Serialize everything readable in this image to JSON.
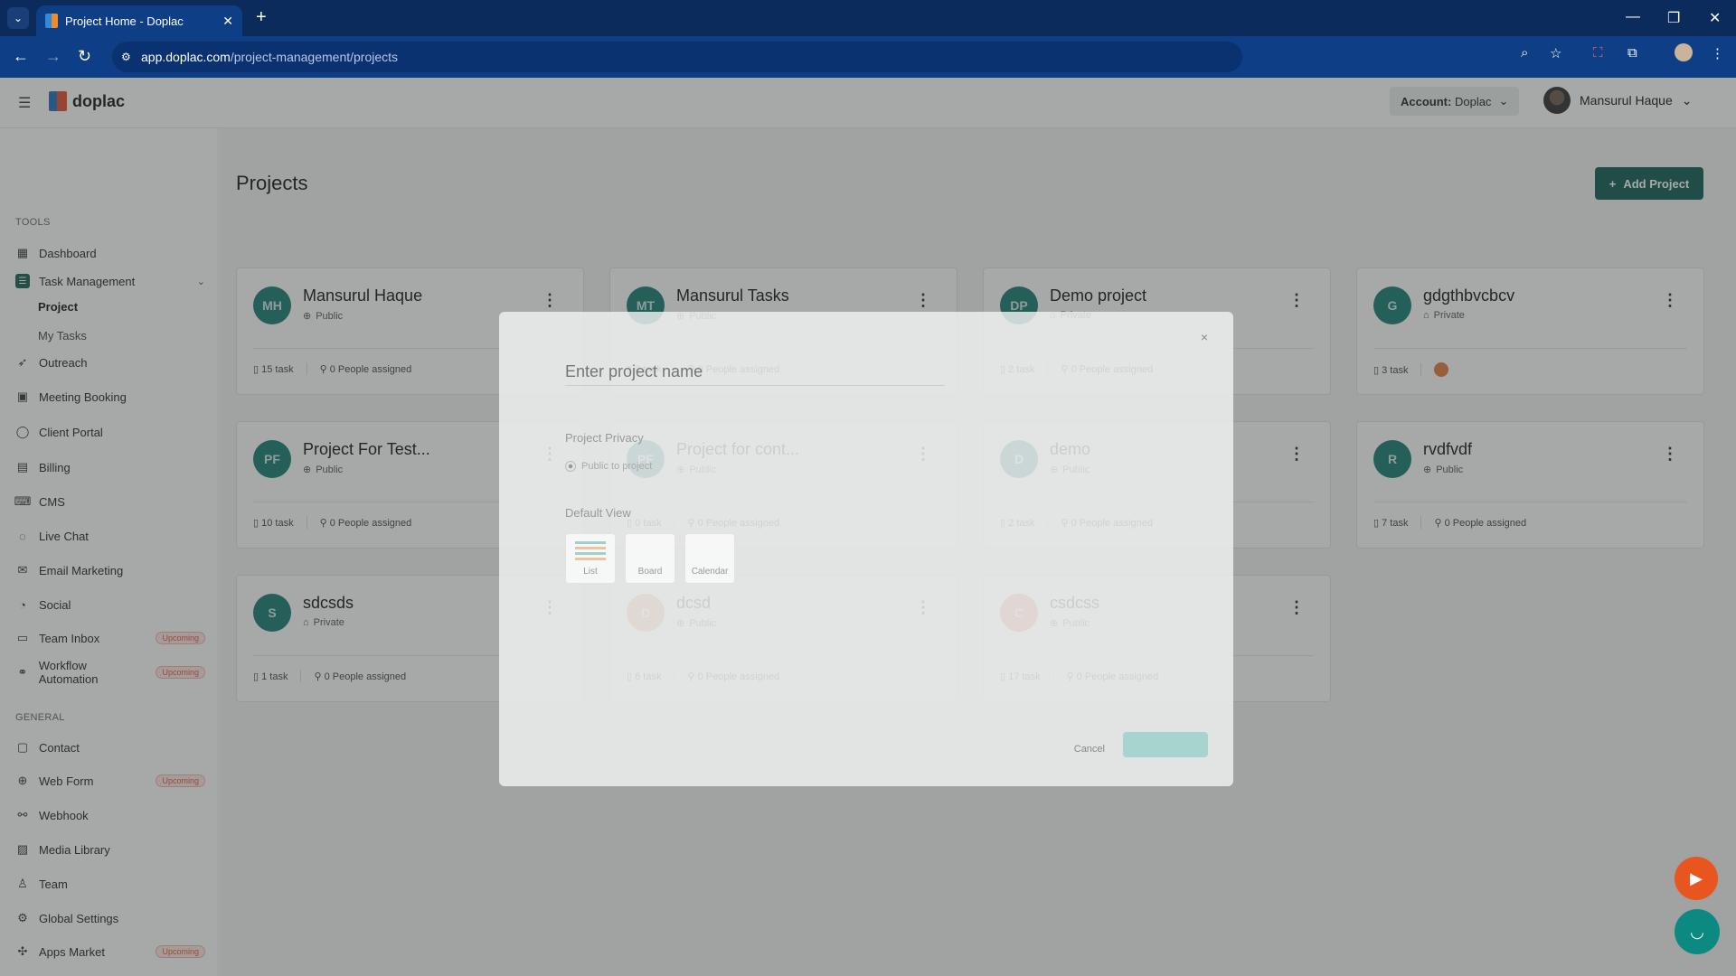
{
  "browser": {
    "tab_title": "Project Home - Doplac",
    "url_host": "app.doplac.com",
    "url_path": "/project-management/projects"
  },
  "header": {
    "logo_text": "doplac",
    "account_label": "Account:",
    "account_value": "Doplac",
    "user_name": "Mansurul Haque"
  },
  "sidebar": {
    "tools_label": "TOOLS",
    "general_label": "GENERAL",
    "tools": [
      {
        "label": "Dashboard",
        "icon": "grid-icon"
      },
      {
        "label": "Task Management",
        "icon": "task-icon",
        "expanded": true
      },
      {
        "label": "Outreach",
        "icon": "rocket-icon"
      },
      {
        "label": "Meeting Booking",
        "icon": "calendar-icon"
      },
      {
        "label": "Client Portal",
        "icon": "user-icon"
      },
      {
        "label": "Billing",
        "icon": "billing-icon"
      },
      {
        "label": "CMS",
        "icon": "cms-icon"
      },
      {
        "label": "Live Chat",
        "icon": "chat-icon"
      },
      {
        "label": "Email Marketing",
        "icon": "mail-icon"
      },
      {
        "label": "Social",
        "icon": "megaphone-icon"
      },
      {
        "label": "Team Inbox",
        "icon": "inbox-icon",
        "badge": "Upcoming"
      },
      {
        "label": "Workflow Automation",
        "icon": "workflow-icon",
        "badge": "Upcoming"
      }
    ],
    "task_sub": [
      {
        "label": "Project",
        "active": true
      },
      {
        "label": "My Tasks"
      }
    ],
    "general": [
      {
        "label": "Contact",
        "icon": "contact-icon"
      },
      {
        "label": "Web Form",
        "icon": "globe-icon",
        "badge": "Upcoming"
      },
      {
        "label": "Webhook",
        "icon": "webhook-icon"
      },
      {
        "label": "Media Library",
        "icon": "image-icon"
      },
      {
        "label": "Team",
        "icon": "team-icon"
      },
      {
        "label": "Global Settings",
        "icon": "gear-icon"
      },
      {
        "label": "Apps Market",
        "icon": "puzzle-icon",
        "badge": "Upcoming"
      }
    ]
  },
  "main": {
    "title": "Projects",
    "add_button": "Add Project",
    "projects": [
      {
        "initials": "MH",
        "name": "Mansurul Haque",
        "privacy": "Public",
        "tasks": "15 task",
        "people": "0 People assigned"
      },
      {
        "initials": "MT",
        "name": "Mansurul Tasks",
        "privacy": "Public",
        "tasks": "0 task",
        "people": "0 People assigned"
      },
      {
        "initials": "DP",
        "name": "Demo project",
        "privacy": "Private",
        "tasks": "2 task",
        "people": "0 People assigned"
      },
      {
        "initials": "G",
        "name": "gdgthbvcbcv",
        "privacy": "Private",
        "tasks": "3 task",
        "people": ""
      },
      {
        "initials": "PF",
        "name": "Project For Test...",
        "privacy": "Public",
        "tasks": "10 task",
        "people": "0 People assigned"
      },
      {
        "initials": "PF",
        "name": "Project for cont...",
        "privacy": "Public",
        "tasks": "0 task",
        "people": "0 People assigned"
      },
      {
        "initials": "D",
        "name": "demo",
        "privacy": "Public",
        "tasks": "2 task",
        "people": "0 People assigned"
      },
      {
        "initials": "R",
        "name": "rvdfvdf",
        "privacy": "Public",
        "tasks": "7 task",
        "people": "0 People assigned"
      },
      {
        "initials": "S",
        "name": "sdcsds",
        "privacy": "Private",
        "tasks": "1 task",
        "people": "0 People assigned"
      },
      {
        "initials": "D",
        "name": "dcsd",
        "privacy": "Public",
        "tasks": "6 task",
        "people": "0 People assigned"
      },
      {
        "initials": "C",
        "name": "csdcss",
        "privacy": "Public",
        "tasks": "17 task",
        "people": "0 People assigned"
      }
    ]
  },
  "modal": {
    "name_placeholder": "Enter project name",
    "privacy_label": "Project Privacy",
    "privacy_option": "Public to project",
    "default_view_label": "Default View",
    "views": [
      "List",
      "Board",
      "Calendar"
    ],
    "cancel": "Cancel",
    "close": "×"
  }
}
